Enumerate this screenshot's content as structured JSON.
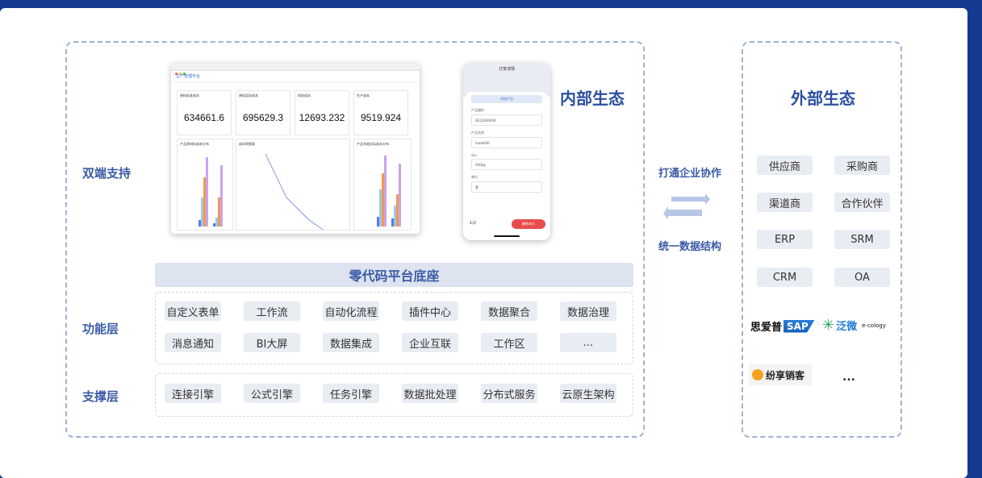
{
  "labels": {
    "dual": "双端支持",
    "function": "功能层",
    "support": "支撑层",
    "internal": "内部生态",
    "external": "外部生态",
    "zero_code": "零代码平台底座",
    "connect": "打通企业协作",
    "unify": "统一数据结构"
  },
  "function_layer": [
    "自定义表单",
    "工作流",
    "自动化流程",
    "插件中心",
    "数据聚合",
    "数据治理",
    "消息通知",
    "BI大屏",
    "数据集成",
    "企业互联",
    "工作区",
    "..."
  ],
  "support_layer": [
    "连接引擎",
    "公式引擎",
    "任务引擎",
    "数据批处理",
    "分布式服务",
    "云原生架构"
  ],
  "external_items": [
    "供应商",
    "采购商",
    "渠道商",
    "合作伙伴",
    "ERP",
    "SRM",
    "CRM",
    "OA"
  ],
  "logos": {
    "sibaopu": "思爱普",
    "sap": "SAP",
    "fanwei": "泛微",
    "ecology": "e-cology",
    "fenxiang": "纷享销客",
    "more": "..."
  },
  "desktop": {
    "app_title": "生产管理平台",
    "stats": [
      {
        "label": "原料标准成本",
        "value": "634661.6"
      },
      {
        "label": "原料实际成本",
        "value": "695629.3"
      },
      {
        "label": "研发成本",
        "value": "12693.232"
      },
      {
        "label": "生产成本",
        "value": "9519.924"
      }
    ],
    "panels": [
      "产品原材料成本分布",
      "成本率图表",
      "产品年度实际成本分布"
    ]
  },
  "phone": {
    "header": "订单详情",
    "button": "添加产品",
    "fields": [
      {
        "label": "产品编码",
        "value": "XE12000444"
      },
      {
        "label": "产品名称",
        "value": "model60"
      },
      {
        "label": "sku",
        "value": "200kg"
      },
      {
        "label": "单位",
        "value": "套"
      }
    ],
    "pager": "1/2",
    "submit": "删除本行"
  },
  "colors": {
    "background": "#143a8f",
    "accent": "#3b5ba5",
    "chip": "#e8ecf3",
    "arrow": "#b6c6e6"
  }
}
